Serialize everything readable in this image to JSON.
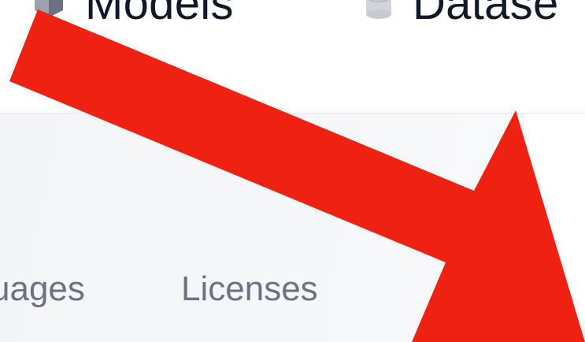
{
  "nav": {
    "items": [
      {
        "label": "Models",
        "icon": "models-box-icon"
      },
      {
        "label": "Datase",
        "icon": "datasets-cylinder-icon"
      }
    ]
  },
  "filters": {
    "tabs": [
      {
        "label": "uages"
      },
      {
        "label": "Licenses"
      }
    ]
  },
  "annotation": {
    "arrow_color": "#ee2212",
    "icon": "red-arrow-icon"
  },
  "colors": {
    "nav_text": "#111827",
    "tab_text": "#6b7280",
    "panel_bg": "#f4f6f8"
  }
}
